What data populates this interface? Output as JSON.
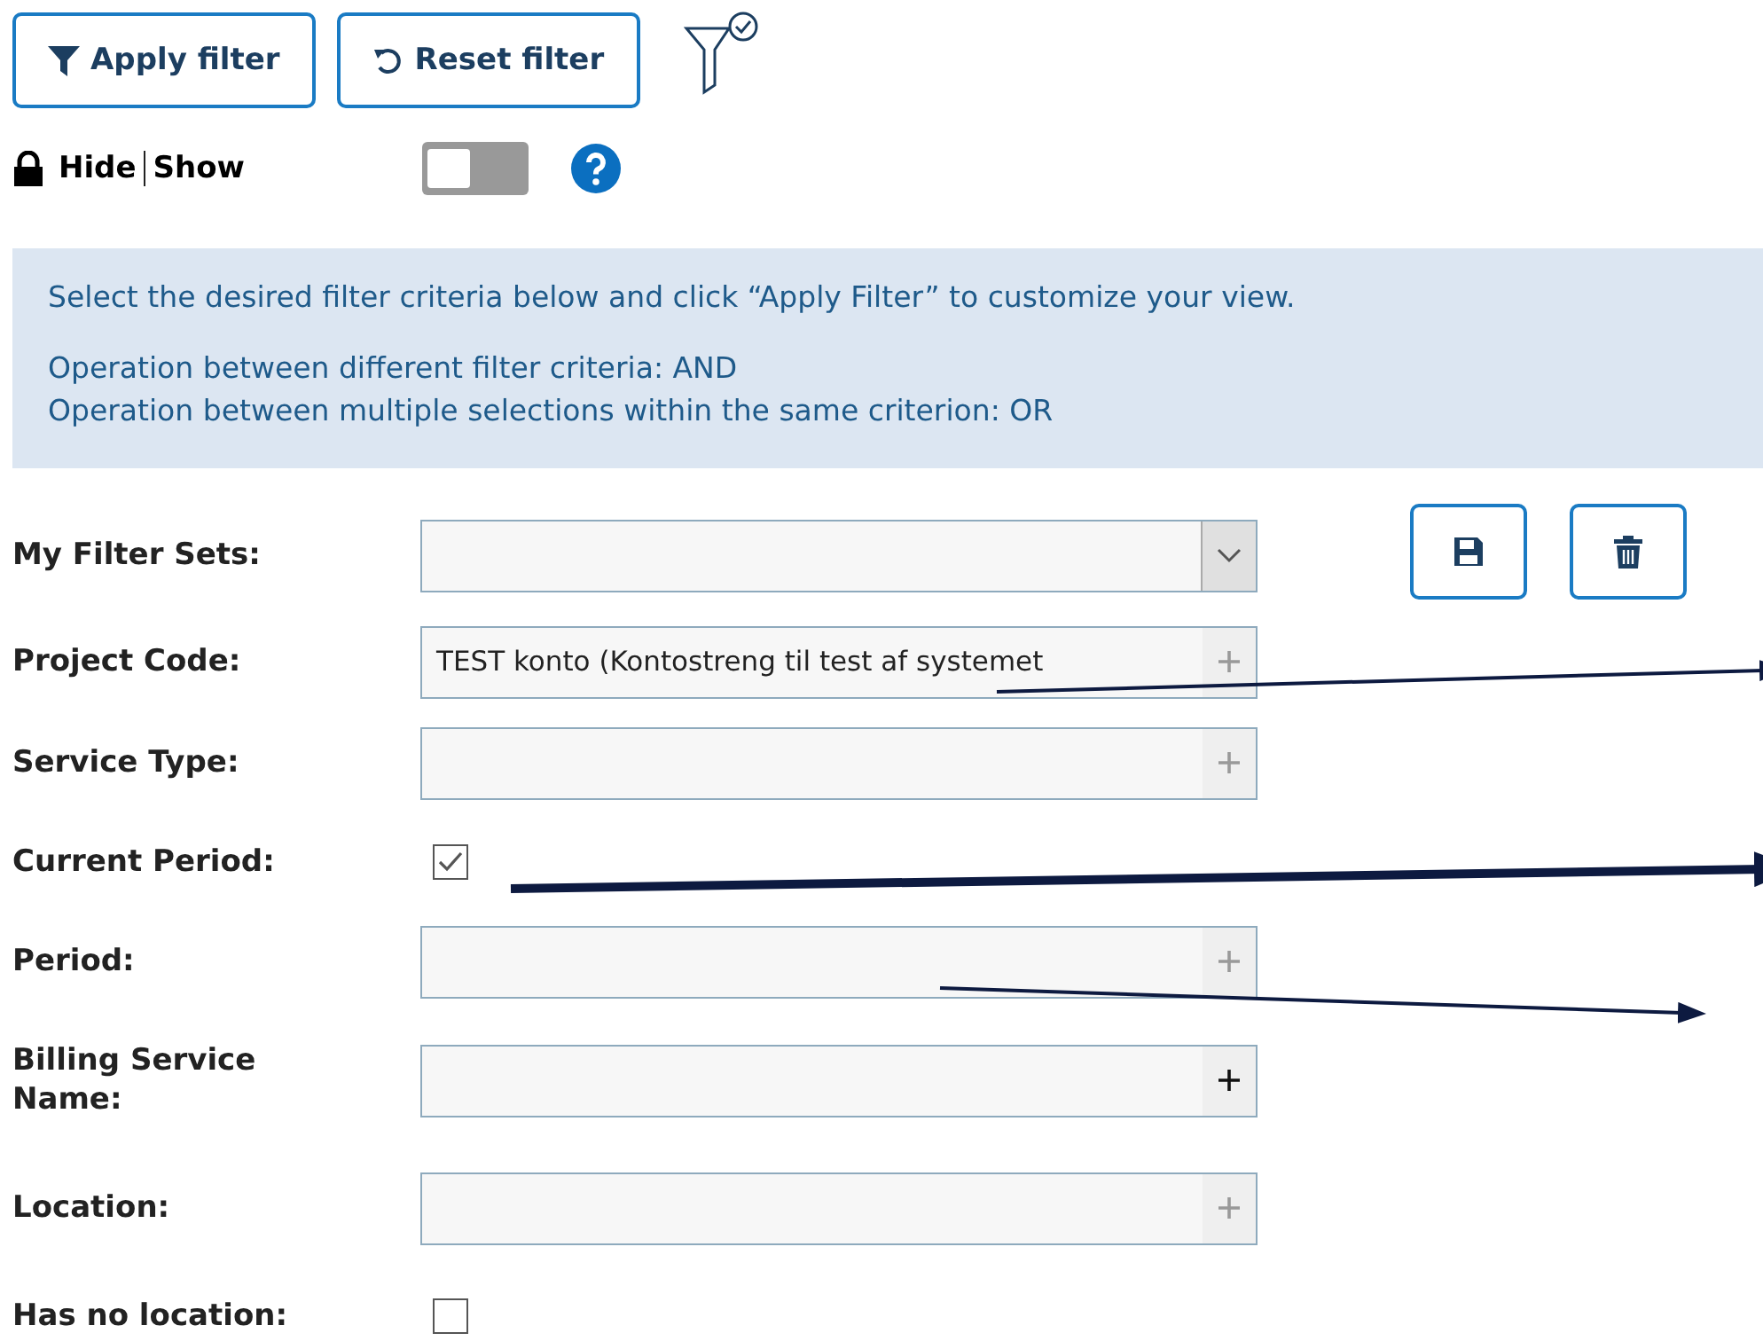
{
  "toolbar": {
    "buttons": [
      {
        "kind": "apply",
        "label": "Apply filter"
      },
      {
        "kind": "reset",
        "label": "Reset filter"
      }
    ]
  },
  "visibility": {
    "hide_label": "Hide",
    "show_label": "Show",
    "on": false
  },
  "info": {
    "lines": [
      "Select the desired filter criteria below and click “Apply Filter” to customize your view.",
      "Operation between different filter criteria: AND",
      "Operation between multiple selections within the same criterion: OR"
    ]
  },
  "fields": [
    {
      "kind": "select",
      "label": "My Filter Sets:"
    },
    {
      "kind": "picker",
      "label": "Project Code:",
      "value": "TEST konto (Kontostreng til test af systemet",
      "disabled": true
    },
    {
      "kind": "picker",
      "label": "Service Type:",
      "disabled": true
    },
    {
      "kind": "checkbox",
      "label": "Current Period:",
      "checked": true
    },
    {
      "kind": "picker",
      "label": "Period:",
      "disabled": true
    },
    {
      "kind": "picker",
      "label": "Billing Service Name:",
      "disabled": false
    },
    {
      "kind": "picker",
      "label": "Location:",
      "disabled": true
    },
    {
      "kind": "checkbox",
      "label": "Has no location:",
      "checked": false
    }
  ]
}
